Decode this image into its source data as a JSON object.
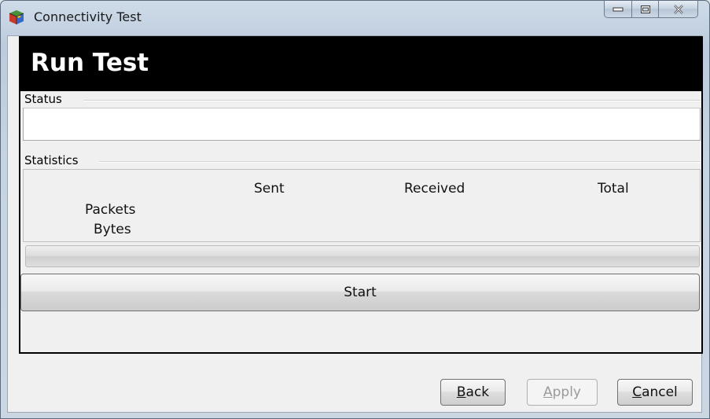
{
  "window": {
    "title": "Connectivity Test",
    "icons": {
      "app": "colored-cube-icon",
      "minimize": "minimize-icon",
      "maximize": "maximize-icon",
      "close": "close-icon"
    }
  },
  "header": {
    "title": "Run Test"
  },
  "status": {
    "label": "Status",
    "value": ""
  },
  "statistics": {
    "label": "Statistics",
    "columns": [
      "Sent",
      "Received",
      "Total"
    ],
    "rows": [
      "Packets",
      "Bytes"
    ]
  },
  "progress": {
    "value_percent": 0,
    "fill_color": "#3fbf3f"
  },
  "start_label": "Start",
  "buttons": {
    "back": {
      "mnemonic": "B",
      "rest": "ack",
      "enabled": true
    },
    "apply": {
      "mnemonic": "A",
      "rest": "pply",
      "enabled": false
    },
    "cancel": {
      "mnemonic": "C",
      "rest": "ancel",
      "enabled": true
    }
  }
}
